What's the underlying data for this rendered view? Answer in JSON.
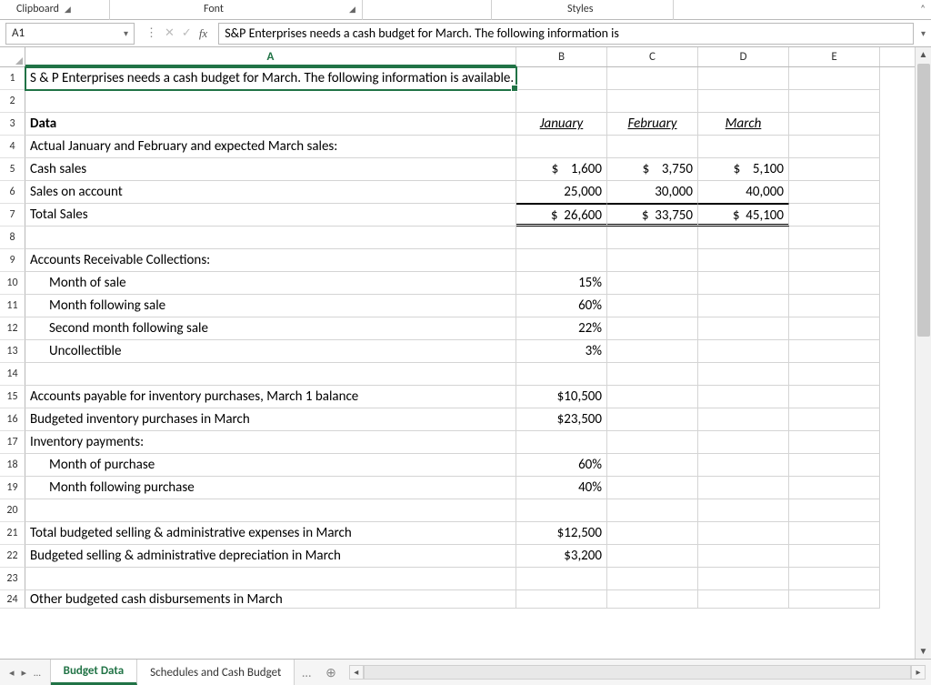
{
  "ribbon": {
    "clipboard": "Clipboard",
    "font": "Font",
    "styles": "Styles"
  },
  "namebox": "A1",
  "formula": "S&P Enterprises needs a cash budget for March. The following information is",
  "columns": [
    "A",
    "B",
    "C",
    "D",
    "E"
  ],
  "rows": {
    "r1": "S & P Enterprises needs a cash budget for March. The following information is available.",
    "r3": {
      "A": "Data",
      "B": "January",
      "C": "February",
      "D": "March"
    },
    "r4": "Actual January and February and expected March sales:",
    "r5": {
      "A": "Cash sales",
      "B": "$    1,600",
      "C": "$    3,750",
      "D": "$    5,100"
    },
    "r6": {
      "A": "Sales on account",
      "B": "25,000",
      "C": "30,000",
      "D": "40,000"
    },
    "r7": {
      "A": "Total Sales",
      "B": "$  26,600",
      "C": "$  33,750",
      "D": "$  45,100"
    },
    "r9": "Accounts Receivable Collections:",
    "r10": {
      "A": "Month of sale",
      "B": "15%"
    },
    "r11": {
      "A": "Month following sale",
      "B": "60%"
    },
    "r12": {
      "A": "Second month following sale",
      "B": "22%"
    },
    "r13": {
      "A": "Uncollectible",
      "B": "3%"
    },
    "r15": {
      "A": "Accounts payable for inventory purchases, March 1 balance",
      "B": "$10,500"
    },
    "r16": {
      "A": "Budgeted inventory purchases in March",
      "B": "$23,500"
    },
    "r17": "Inventory payments:",
    "r18": {
      "A": "Month of purchase",
      "B": "60%"
    },
    "r19": {
      "A": "Month following purchase",
      "B": "40%"
    },
    "r21": {
      "A": "Total budgeted selling & administrative expenses in March",
      "B": "$12,500"
    },
    "r22": {
      "A": "Budgeted selling & administrative depreciation in March",
      "B": "$3,200"
    },
    "r24": "Other budgeted cash disbursements in March"
  },
  "tabs": {
    "active": "Budget Data",
    "other": "Schedules and Cash Budget"
  },
  "chart_data": null
}
